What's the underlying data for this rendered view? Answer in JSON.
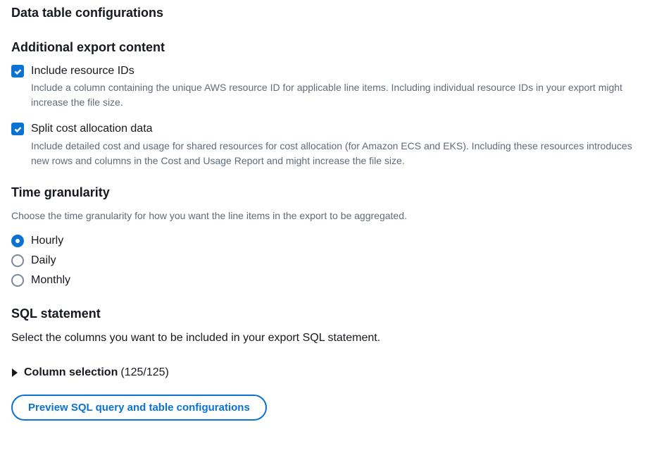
{
  "page": {
    "title": "Data table configurations"
  },
  "additionalExport": {
    "heading": "Additional export content",
    "options": [
      {
        "label": "Include resource IDs",
        "description": "Include a column containing the unique AWS resource ID for applicable line items. Including individual resource IDs in your export might increase the file size.",
        "checked": true
      },
      {
        "label": "Split cost allocation data",
        "description": "Include detailed cost and usage for shared resources for cost allocation (for Amazon ECS and EKS). Including these resources introduces new rows and columns in the Cost and Usage Report and might increase the file size.",
        "checked": true
      }
    ]
  },
  "timeGranularity": {
    "heading": "Time granularity",
    "description": "Choose the time granularity for how you want the line items in the export to be aggregated.",
    "options": [
      {
        "label": "Hourly",
        "selected": true
      },
      {
        "label": "Daily",
        "selected": false
      },
      {
        "label": "Monthly",
        "selected": false
      }
    ]
  },
  "sql": {
    "heading": "SQL statement",
    "description": "Select the columns you want to be included in your export SQL statement.",
    "columnSelection": {
      "label": "Column selection",
      "count": "(125/125)"
    },
    "previewButton": "Preview SQL query and table configurations"
  }
}
